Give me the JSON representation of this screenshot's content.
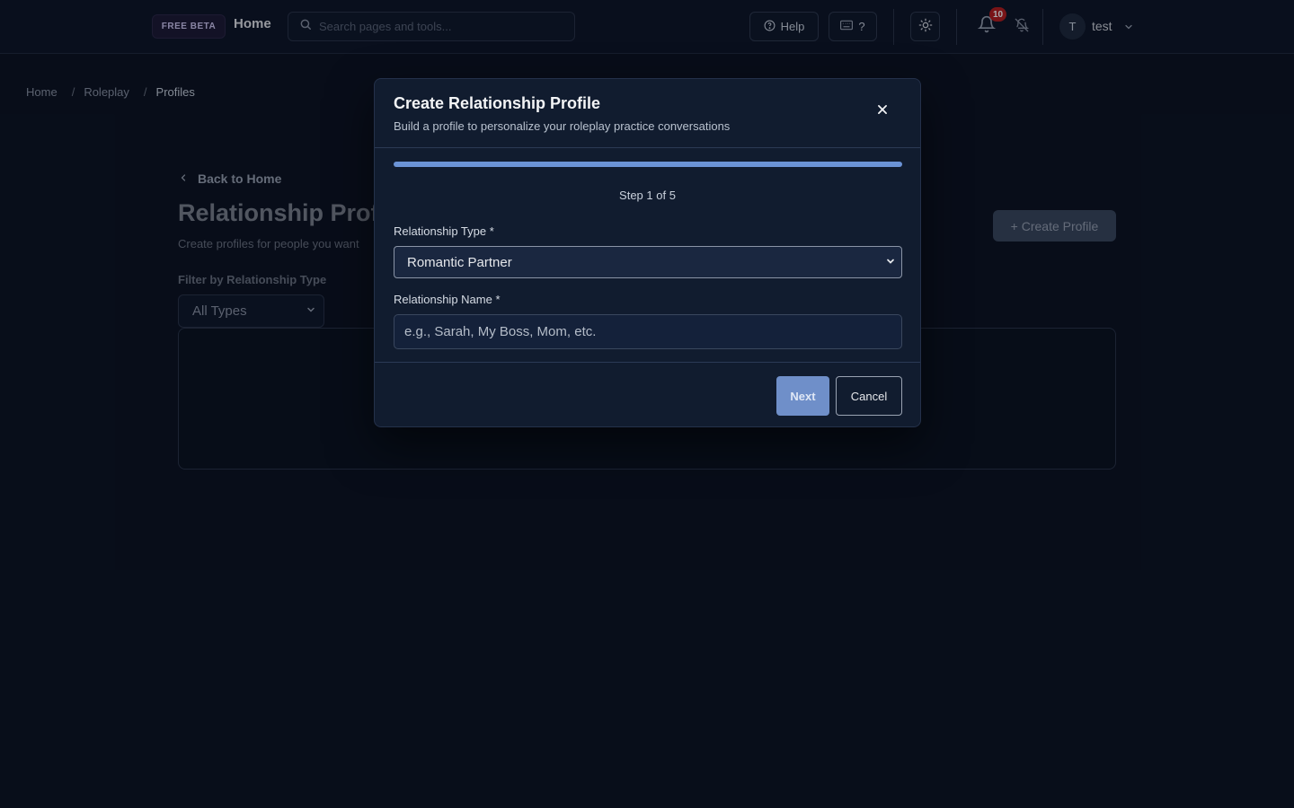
{
  "topbar": {
    "beta_badge": "FREE BETA",
    "home_label": "Home",
    "search_placeholder": "Search pages and tools...",
    "help_label": "Help",
    "keyboard_label": "?",
    "notification_count": "10",
    "user_initial": "T",
    "user_name": "test"
  },
  "breadcrumb": {
    "items": [
      "Home",
      "Roleplay",
      "Profiles"
    ],
    "separator": "/"
  },
  "page": {
    "back_label": "Back to Home",
    "title": "Relationship Profiles",
    "subtitle": "Create profiles for people you want",
    "create_button": "+ Create Profile",
    "filter_label": "Filter by Relationship Type",
    "filter_value": "All Types"
  },
  "modal": {
    "title": "Create Relationship Profile",
    "subtitle": "Build a profile to personalize your roleplay practice conversations",
    "progress_fraction": 1.0,
    "step_text": "Step 1 of 5",
    "type_label": "Relationship Type *",
    "type_value": "Romantic Partner",
    "name_label": "Relationship Name *",
    "name_placeholder": "e.g., Sarah, My Boss, Mom, etc.",
    "next_label": "Next",
    "cancel_label": "Cancel"
  },
  "colors": {
    "background": "#0b1220",
    "modal_bg": "#111c2f",
    "accent": "#6b93d6",
    "badge_red": "#b91c1c"
  }
}
